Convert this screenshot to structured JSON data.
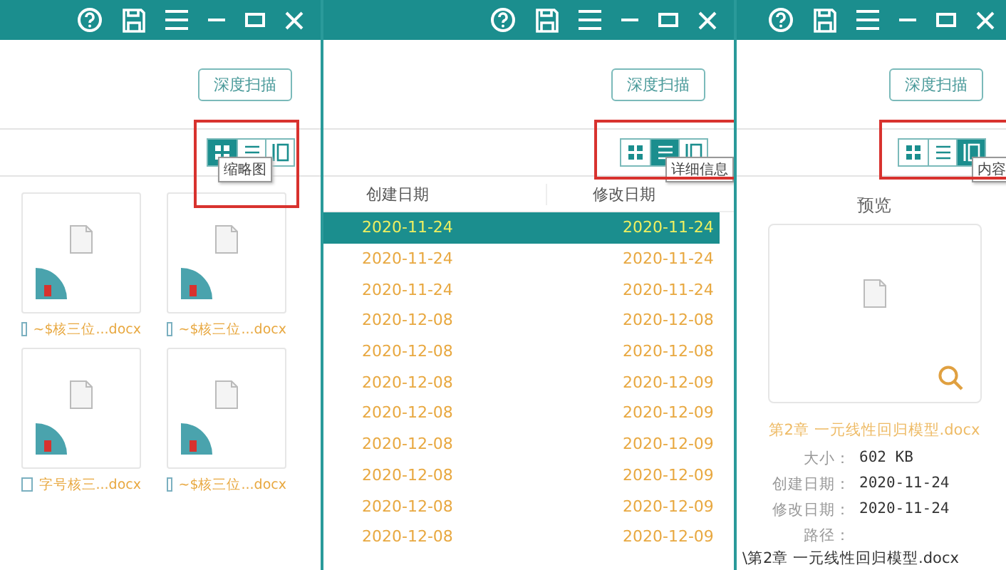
{
  "panels": [
    {
      "kind": "thumbnails",
      "deep_scan_button": "深度扫描",
      "highlighted": true,
      "view_modes": [
        {
          "selected": true
        },
        {
          "selected": false
        },
        {
          "selected": false
        }
      ],
      "tooltip": "缩略图",
      "files": [
        {
          "name": "~$核三位...docx",
          "checked": false
        },
        {
          "name": "~$核三位...docx",
          "checked": false
        },
        {
          "name": "字号核三...docx",
          "checked": false
        },
        {
          "name": "~$核三位...docx",
          "checked": false
        }
      ]
    },
    {
      "kind": "details",
      "deep_scan_button": "深度扫描",
      "highlighted": true,
      "view_modes": [
        {
          "selected": false
        },
        {
          "selected": true
        },
        {
          "selected": false
        }
      ],
      "tooltip": "详细信息",
      "columns": [
        "创建日期",
        "修改日期"
      ],
      "rows": [
        {
          "cells": [
            "2020-11-24",
            "2020-11-24"
          ],
          "selected": true
        },
        {
          "cells": [
            "2020-11-24",
            "2020-11-24"
          ],
          "selected": false
        },
        {
          "cells": [
            "2020-11-24",
            "2020-11-24"
          ],
          "selected": false
        },
        {
          "cells": [
            "2020-12-08",
            "2020-12-08"
          ],
          "selected": false
        },
        {
          "cells": [
            "2020-12-08",
            "2020-12-08"
          ],
          "selected": false
        },
        {
          "cells": [
            "2020-12-08",
            "2020-12-09"
          ],
          "selected": false
        },
        {
          "cells": [
            "2020-12-08",
            "2020-12-09"
          ],
          "selected": false
        },
        {
          "cells": [
            "2020-12-08",
            "2020-12-09"
          ],
          "selected": false
        },
        {
          "cells": [
            "2020-12-08",
            "2020-12-09"
          ],
          "selected": false
        },
        {
          "cells": [
            "2020-12-08",
            "2020-12-09"
          ],
          "selected": false
        },
        {
          "cells": [
            "2020-12-08",
            "2020-12-09"
          ],
          "selected": false
        }
      ]
    },
    {
      "kind": "preview",
      "deep_scan_button": "深度扫描",
      "highlighted": true,
      "view_modes": [
        {
          "selected": false
        },
        {
          "selected": false
        },
        {
          "selected": true
        }
      ],
      "tooltip": "内容",
      "heading": "预览",
      "file_name": "第2章 一元线性回归模型.docx",
      "details": [
        {
          "label": "大小：",
          "value": "602 KB"
        },
        {
          "label": "创建日期：",
          "value": "2020-11-24"
        },
        {
          "label": "修改日期：",
          "value": "2020-11-24"
        },
        {
          "label": "路径："
        }
      ],
      "path": "\\第2章 一元线性回归模型.docx"
    }
  ]
}
